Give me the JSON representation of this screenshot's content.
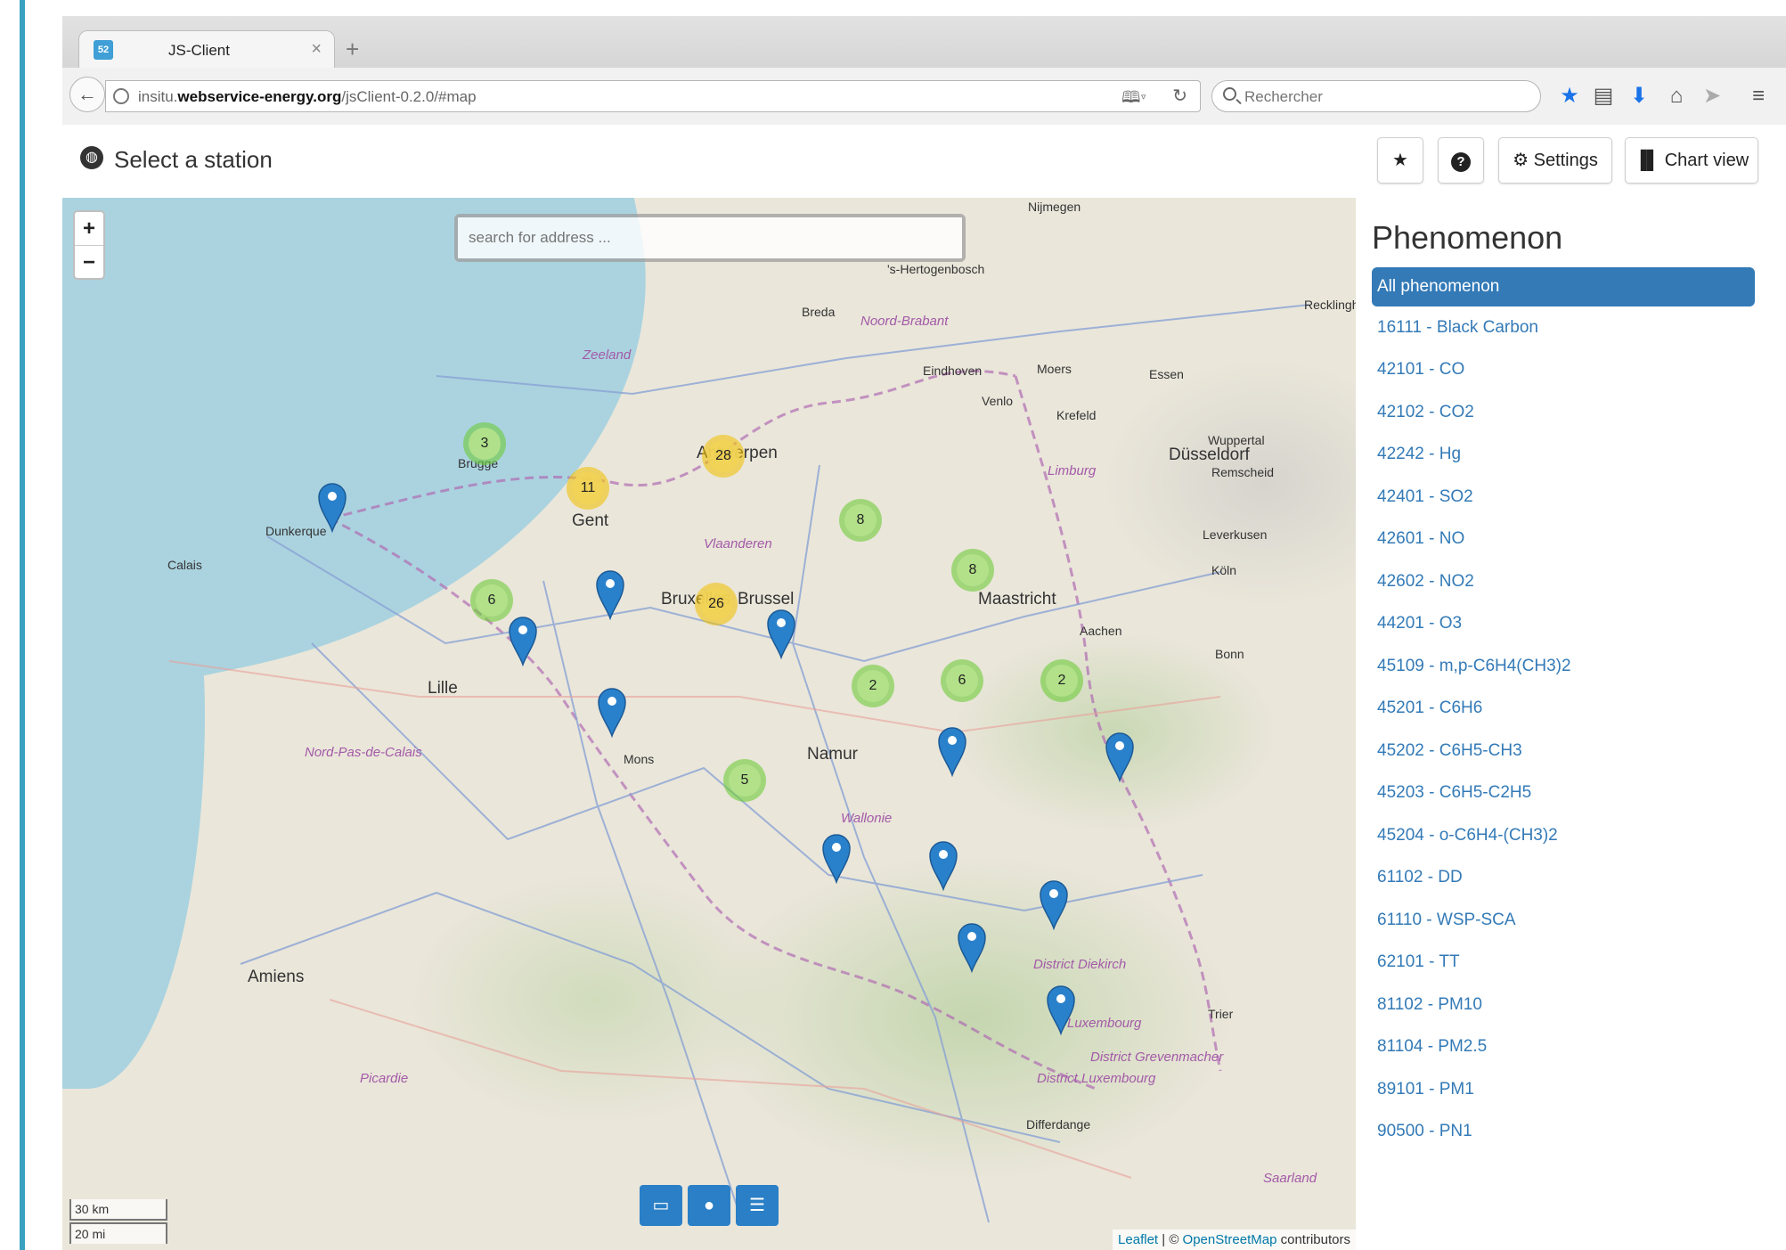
{
  "browser": {
    "tab_title": "JS-Client",
    "tab_close": "×",
    "tab_new": "+",
    "favicon_label": "52",
    "url_host_prefix": "insitu.",
    "url_domain": "webservice-energy.org",
    "url_path": "/jsClient-0.2.0/#map",
    "search_placeholder": "Rechercher",
    "toolbar_icons": [
      "bookmark-star-icon",
      "reading-list-icon",
      "download-icon",
      "home-icon",
      "send-icon",
      "menu-icon"
    ]
  },
  "header": {
    "title": "Select a station",
    "settings_label": "Settings",
    "chart_view_label": "Chart view"
  },
  "map": {
    "search_placeholder": "search for address ...",
    "zoom_in": "+",
    "zoom_out": "−",
    "scale_km": "30 km",
    "scale_mi": "20 mi",
    "attribution_leaflet": "Leaflet",
    "attribution_sep": " | © ",
    "attribution_osm": "OpenStreetMap",
    "attribution_tail": " contributors",
    "places": [
      {
        "name": "Antwerpen",
        "big": true
      },
      {
        "name": "Gent",
        "big": true
      },
      {
        "name": "Bruxelles",
        "big": true
      },
      {
        "name": "Brussel",
        "big": true
      },
      {
        "name": "Maastricht",
        "big": true
      },
      {
        "name": "Lille",
        "big": true
      },
      {
        "name": "Namur",
        "big": true
      },
      {
        "name": "Amiens",
        "big": true
      },
      {
        "name": "Düsseldorf",
        "big": true
      },
      {
        "name": "Dunkerque"
      },
      {
        "name": "Calais"
      },
      {
        "name": "Brugge"
      },
      {
        "name": "Mons"
      },
      {
        "name": "Breda"
      },
      {
        "name": "Eindhoven"
      },
      {
        "name": "Venlo"
      },
      {
        "name": "Krefeld"
      },
      {
        "name": "Moers"
      },
      {
        "name": "Essen"
      },
      {
        "name": "Wuppertal"
      },
      {
        "name": "Remscheid"
      },
      {
        "name": "Leverkusen"
      },
      {
        "name": "Köln"
      },
      {
        "name": "Aachen"
      },
      {
        "name": "Bonn"
      },
      {
        "name": "Trier"
      },
      {
        "name": "Differdange"
      },
      {
        "name": "Nijmegen"
      },
      {
        "name": "'s-Hertogenbosch"
      },
      {
        "name": "Recklinghausen"
      },
      {
        "name": "Zeeland",
        "region": true
      },
      {
        "name": "Noord-Brabant",
        "region": true
      },
      {
        "name": "Limburg",
        "region": true
      },
      {
        "name": "Vlaanderen",
        "region": true
      },
      {
        "name": "Wallonie",
        "region": true
      },
      {
        "name": "Nord-Pas-de-Calais",
        "region": true
      },
      {
        "name": "Picardie",
        "region": true
      },
      {
        "name": "District Diekirch",
        "region": true
      },
      {
        "name": "Luxembourg",
        "region": true
      },
      {
        "name": "District Grevenmacher",
        "region": true
      },
      {
        "name": "District Luxembourg",
        "region": true
      },
      {
        "name": "Saarland",
        "region": true
      }
    ],
    "clusters": [
      {
        "count": "3",
        "color": "green"
      },
      {
        "count": "11",
        "color": "yellow"
      },
      {
        "count": "28",
        "color": "yellow"
      },
      {
        "count": "8",
        "color": "green"
      },
      {
        "count": "8",
        "color": "green"
      },
      {
        "count": "6",
        "color": "green"
      },
      {
        "count": "26",
        "color": "yellow"
      },
      {
        "count": "2",
        "color": "green"
      },
      {
        "count": "6",
        "color": "green"
      },
      {
        "count": "2",
        "color": "green"
      },
      {
        "count": "5",
        "color": "green"
      }
    ],
    "marker_count": 12,
    "tool_icons": [
      "folder-open-icon",
      "map-marker-icon",
      "list-icon"
    ]
  },
  "sidebar": {
    "title": "Phenomenon",
    "items": [
      "All phenomenon",
      "16111 - Black Carbon",
      "42101 - CO",
      "42102 - CO2",
      "42242 - Hg",
      "42401 - SO2",
      "42601 - NO",
      "42602 - NO2",
      "44201 - O3",
      "45109 - m,p-C6H4(CH3)2",
      "45201 - C6H6",
      "45202 - C6H5-CH3",
      "45203 - C6H5-C2H5",
      "45204 - o-C6H4-(CH3)2",
      "61102 - DD",
      "61110 - WSP-SCA",
      "62101 - TT",
      "81102 - PM10",
      "81104 - PM2.5",
      "89101 - PM1",
      "90500 - PN1"
    ],
    "active_index": 0
  },
  "colors": {
    "accent": "#337ab7",
    "marker": "#2a81cb",
    "cluster_green": "#6ecc39",
    "cluster_yellow": "#f0c20c",
    "sea": "#aad3df"
  }
}
